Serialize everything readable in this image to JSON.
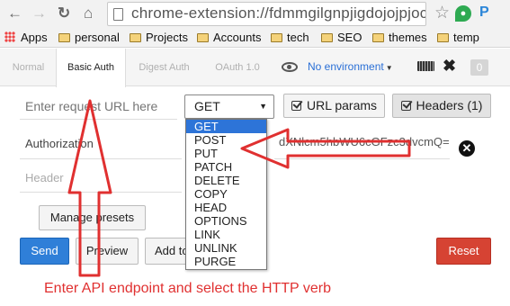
{
  "browser": {
    "url": "chrome-extension://fdmmgilgnpjigdojojpjoc",
    "back_icon": "back-arrow-icon",
    "forward_icon": "forward-arrow-icon",
    "reload_icon": "reload-icon",
    "home_icon": "home-icon",
    "star_icon": "star-icon",
    "ext_p_label": "P"
  },
  "bookmarks": {
    "apps_label": "Apps",
    "folders": [
      "personal",
      "Projects",
      "Accounts",
      "tech",
      "SEO",
      "themes",
      "temp"
    ]
  },
  "app_tabs": {
    "items": [
      "Normal",
      "Basic Auth",
      "Digest Auth",
      "OAuth 1.0"
    ],
    "active": "Basic Auth",
    "environment": "No environment",
    "badge": "0"
  },
  "request": {
    "url_placeholder": "Enter request URL here",
    "method": "GET",
    "url_params_label": "URL params",
    "headers_label": "Headers (1)"
  },
  "headers": {
    "key": "Authorization",
    "value": "dXNlcm5hbWU6cGFzc3dvcmQ=",
    "key_placeholder": "Header"
  },
  "actions": {
    "manage_presets": "Manage presets",
    "send": "Send",
    "preview": "Preview",
    "add_to": "Add to",
    "reset": "Reset"
  },
  "method_menu": {
    "options": [
      "GET",
      "POST",
      "PUT",
      "PATCH",
      "DELETE",
      "COPY",
      "HEAD",
      "OPTIONS",
      "LINK",
      "UNLINK",
      "PURGE"
    ],
    "selected": "GET"
  },
  "annotation": {
    "text": "Enter API endpoint and select the HTTP verb",
    "color": "#e03030"
  },
  "colors": {
    "send": "#2f7fd8",
    "reset": "#d64333",
    "selected_option": "#2d74d8"
  }
}
